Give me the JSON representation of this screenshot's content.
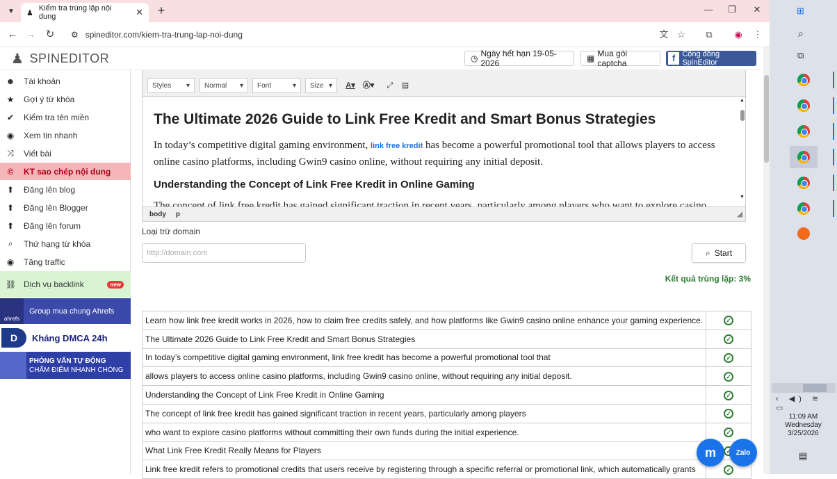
{
  "browser": {
    "tab_title": "Kiểm tra trùng lặp nội dung",
    "url": "spineditor.com/kiem-tra-trung-lap-noi-dung"
  },
  "header": {
    "logo_text": "SPINEDITOR",
    "expiry": "Ngày hết hạn 19-05-2026",
    "captcha": "Mua gói captcha",
    "community": "Cộng đồng SpinEditor"
  },
  "sidebar": {
    "items": [
      {
        "label": "Tài khoản",
        "icon": "user-icon",
        "glyph": "☻"
      },
      {
        "label": "Gợi ý từ khóa",
        "icon": "star-icon",
        "glyph": "★"
      },
      {
        "label": "Kiểm tra tên miền",
        "icon": "check-icon",
        "glyph": "✔"
      },
      {
        "label": "Xem tin nhanh",
        "icon": "eye-icon",
        "glyph": "◉"
      },
      {
        "label": "Viết bài",
        "icon": "shuffle-icon",
        "glyph": "⤨"
      },
      {
        "label": "KT sao chép nội dung",
        "icon": "copyright-icon",
        "glyph": "©"
      },
      {
        "label": "Đăng lên blog",
        "icon": "upload-icon",
        "glyph": "⬆"
      },
      {
        "label": "Đăng lên Blogger",
        "icon": "upload-icon",
        "glyph": "⬆"
      },
      {
        "label": "Đăng lên forum",
        "icon": "upload-icon",
        "glyph": "⬆"
      },
      {
        "label": "Thứ hạng từ khóa",
        "icon": "search-icon",
        "glyph": "⌕"
      },
      {
        "label": "Tăng traffic",
        "icon": "eye-icon",
        "glyph": "◉"
      }
    ],
    "backlink": {
      "label": "Dịch vụ backlink",
      "badge": "new"
    },
    "ahrefs": {
      "label": "Group mua chung Ahrefs",
      "logo": "ahrefs"
    },
    "dmca": {
      "label": "Kháng DMCA 24h"
    },
    "interview": {
      "line1": "PHỎNG VẤN TỰ ĐỘNG",
      "line2": "CHẤM ĐIỂM NHANH CHÓNG"
    }
  },
  "editor": {
    "selects": [
      "Styles",
      "Normal",
      "Font",
      "Size"
    ],
    "title": "The Ultimate 2026 Guide to Link Free Kredit and Smart Bonus Strategies",
    "para_before": "In today’s competitive digital gaming environment, ",
    "para_link": "link free kredit",
    "para_after": " has become a powerful promotional tool that allows players to access online casino platforms, including Gwin9 casino online, without requiring any initial deposit.",
    "subheading": "Understanding the Concept of Link Free Kredit in Online Gaming",
    "cut_line": "The concept of link free kredit has gained significant traction in recent years, particularly among players who want to explore casino platforms",
    "path": [
      "body",
      "p"
    ]
  },
  "exclude": {
    "label": "Loại trừ domain",
    "placeholder": "http://domain.com",
    "start": "Start"
  },
  "result": {
    "label": "Kết quả trùng lặp: 3%"
  },
  "rows": [
    "Learn how link free kredit works in 2026, how to claim free credits safely, and how platforms like Gwin9 casino online enhance your gaming experience.",
    "The Ultimate 2026 Guide to Link Free Kredit and Smart Bonus Strategies",
    "In today’s competitive digital gaming environment, link free kredit has become a powerful promotional tool that",
    "allows players to access online casino platforms, including Gwin9 casino online, without requiring any initial deposit.",
    "Understanding the Concept of Link Free Kredit in Online Gaming",
    "The concept of link free kredit has gained significant traction in recent years, particularly among players",
    "who want to explore casino platforms without committing their own funds during the initial experience.",
    "What Link Free Kredit Really Means for Players",
    "Link free kredit refers to promotional credits that users receive by registering through a specific referral or promotional link, which automatically grants"
  ],
  "chat": {
    "messenger": "m",
    "zalo": "Zalo"
  },
  "clock": {
    "time": "11:09 AM",
    "day": "Wednesday",
    "date": "3/25/2026"
  },
  "colors": {
    "accent": "#b1001c",
    "result": "#2e7d32",
    "facebook": "#3b5998"
  }
}
